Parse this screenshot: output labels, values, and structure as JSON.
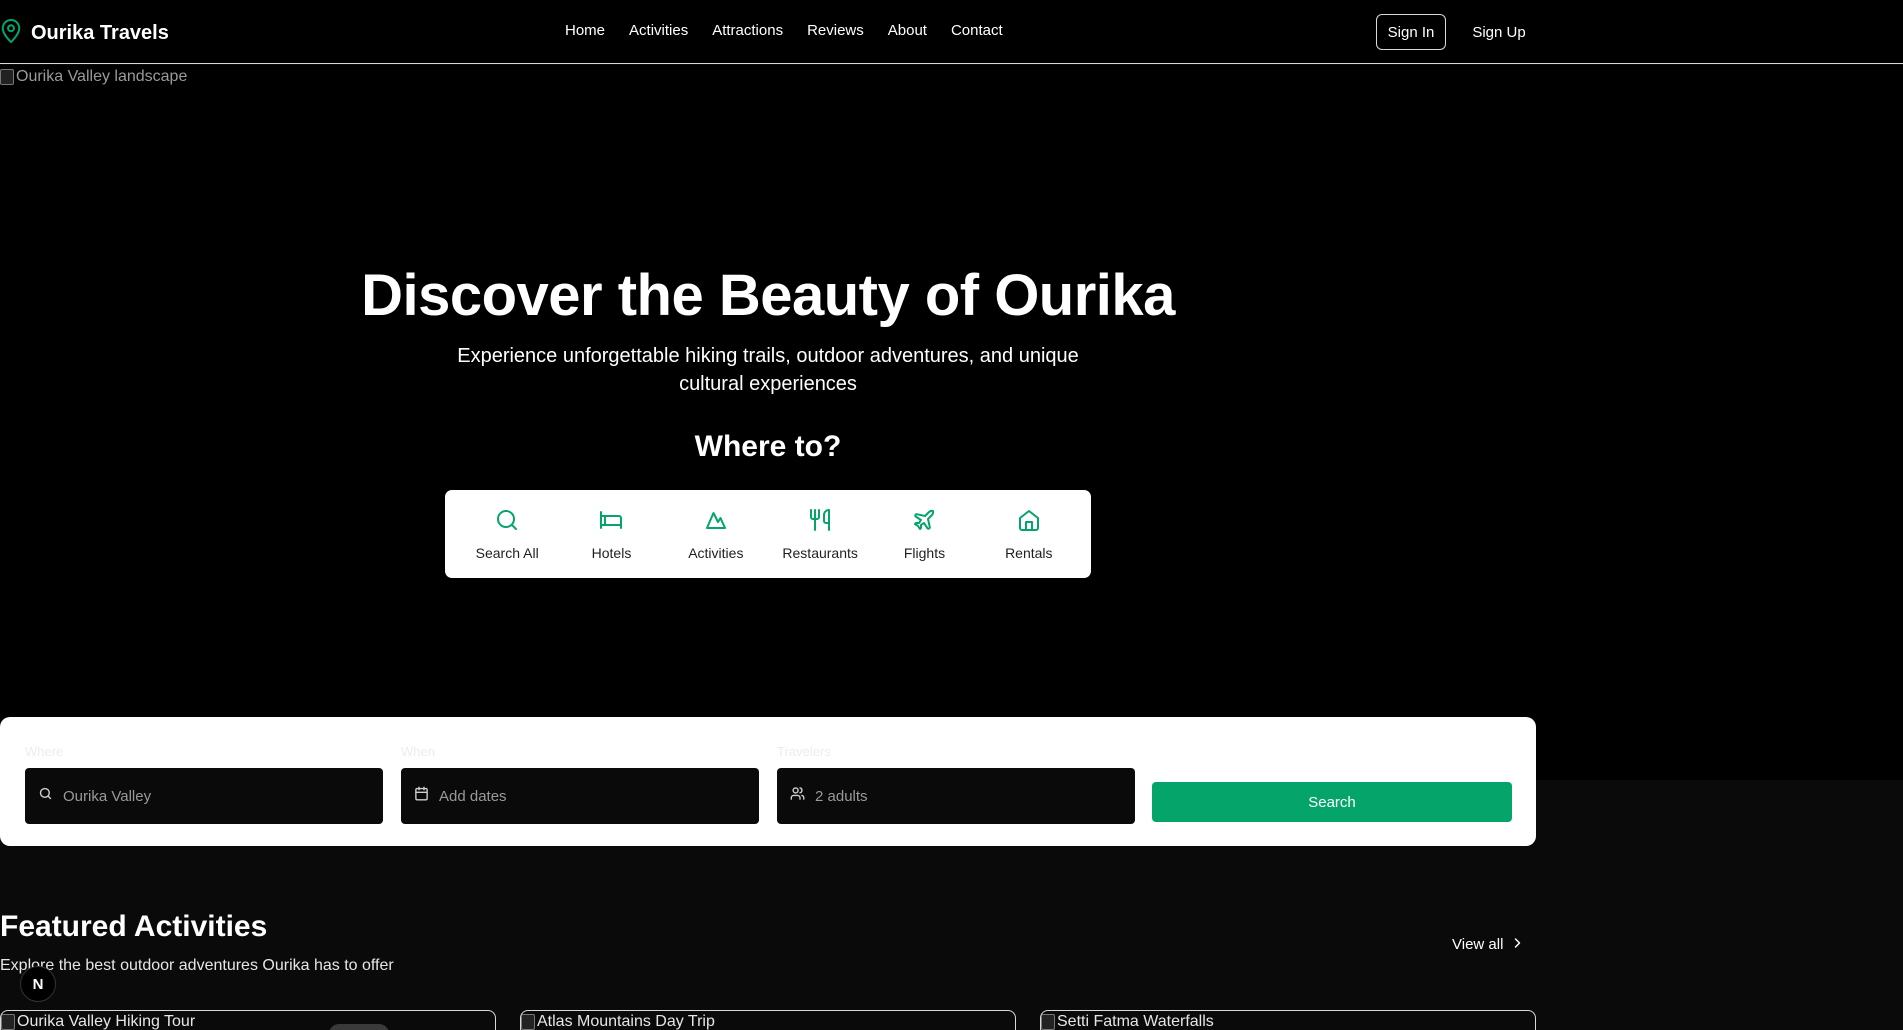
{
  "header": {
    "brand": "Ourika Travels",
    "nav": [
      "Home",
      "Activities",
      "Attractions",
      "Reviews",
      "About",
      "Contact"
    ],
    "sign_in": "Sign In",
    "sign_up": "Sign Up"
  },
  "hero": {
    "image_alt": "Ourika Valley landscape",
    "title": "Discover the Beauty of Ourika",
    "subtitle": "Experience unforgettable hiking trails, outdoor adventures, and unique cultural experiences",
    "where_to": "Where to?",
    "categories": [
      {
        "label": "Search All",
        "icon": "search-icon"
      },
      {
        "label": "Hotels",
        "icon": "bed-icon"
      },
      {
        "label": "Activities",
        "icon": "mountain-icon"
      },
      {
        "label": "Restaurants",
        "icon": "utensils-icon"
      },
      {
        "label": "Flights",
        "icon": "plane-icon"
      },
      {
        "label": "Rentals",
        "icon": "home-icon"
      }
    ]
  },
  "search": {
    "where_label": "Where",
    "where_placeholder": "Ourika Valley",
    "when_label": "When",
    "when_placeholder": "Add dates",
    "travelers_label": "Travelers",
    "travelers_placeholder": "2 adults",
    "button": "Search"
  },
  "featured": {
    "title": "Featured Activities",
    "subtitle": "Explore the best outdoor adventures Ourika has to offer",
    "view_all": "View all",
    "cards": [
      {
        "image_alt": "Ourika Valley Hiking Tour"
      },
      {
        "image_alt": "Atlas Mountains Day Trip"
      },
      {
        "image_alt": "Setti Fatma Waterfalls"
      }
    ]
  },
  "badge": "N",
  "colors": {
    "accent": "#04a46b",
    "background": "#0a0a0a",
    "header_bg": "#000000"
  }
}
